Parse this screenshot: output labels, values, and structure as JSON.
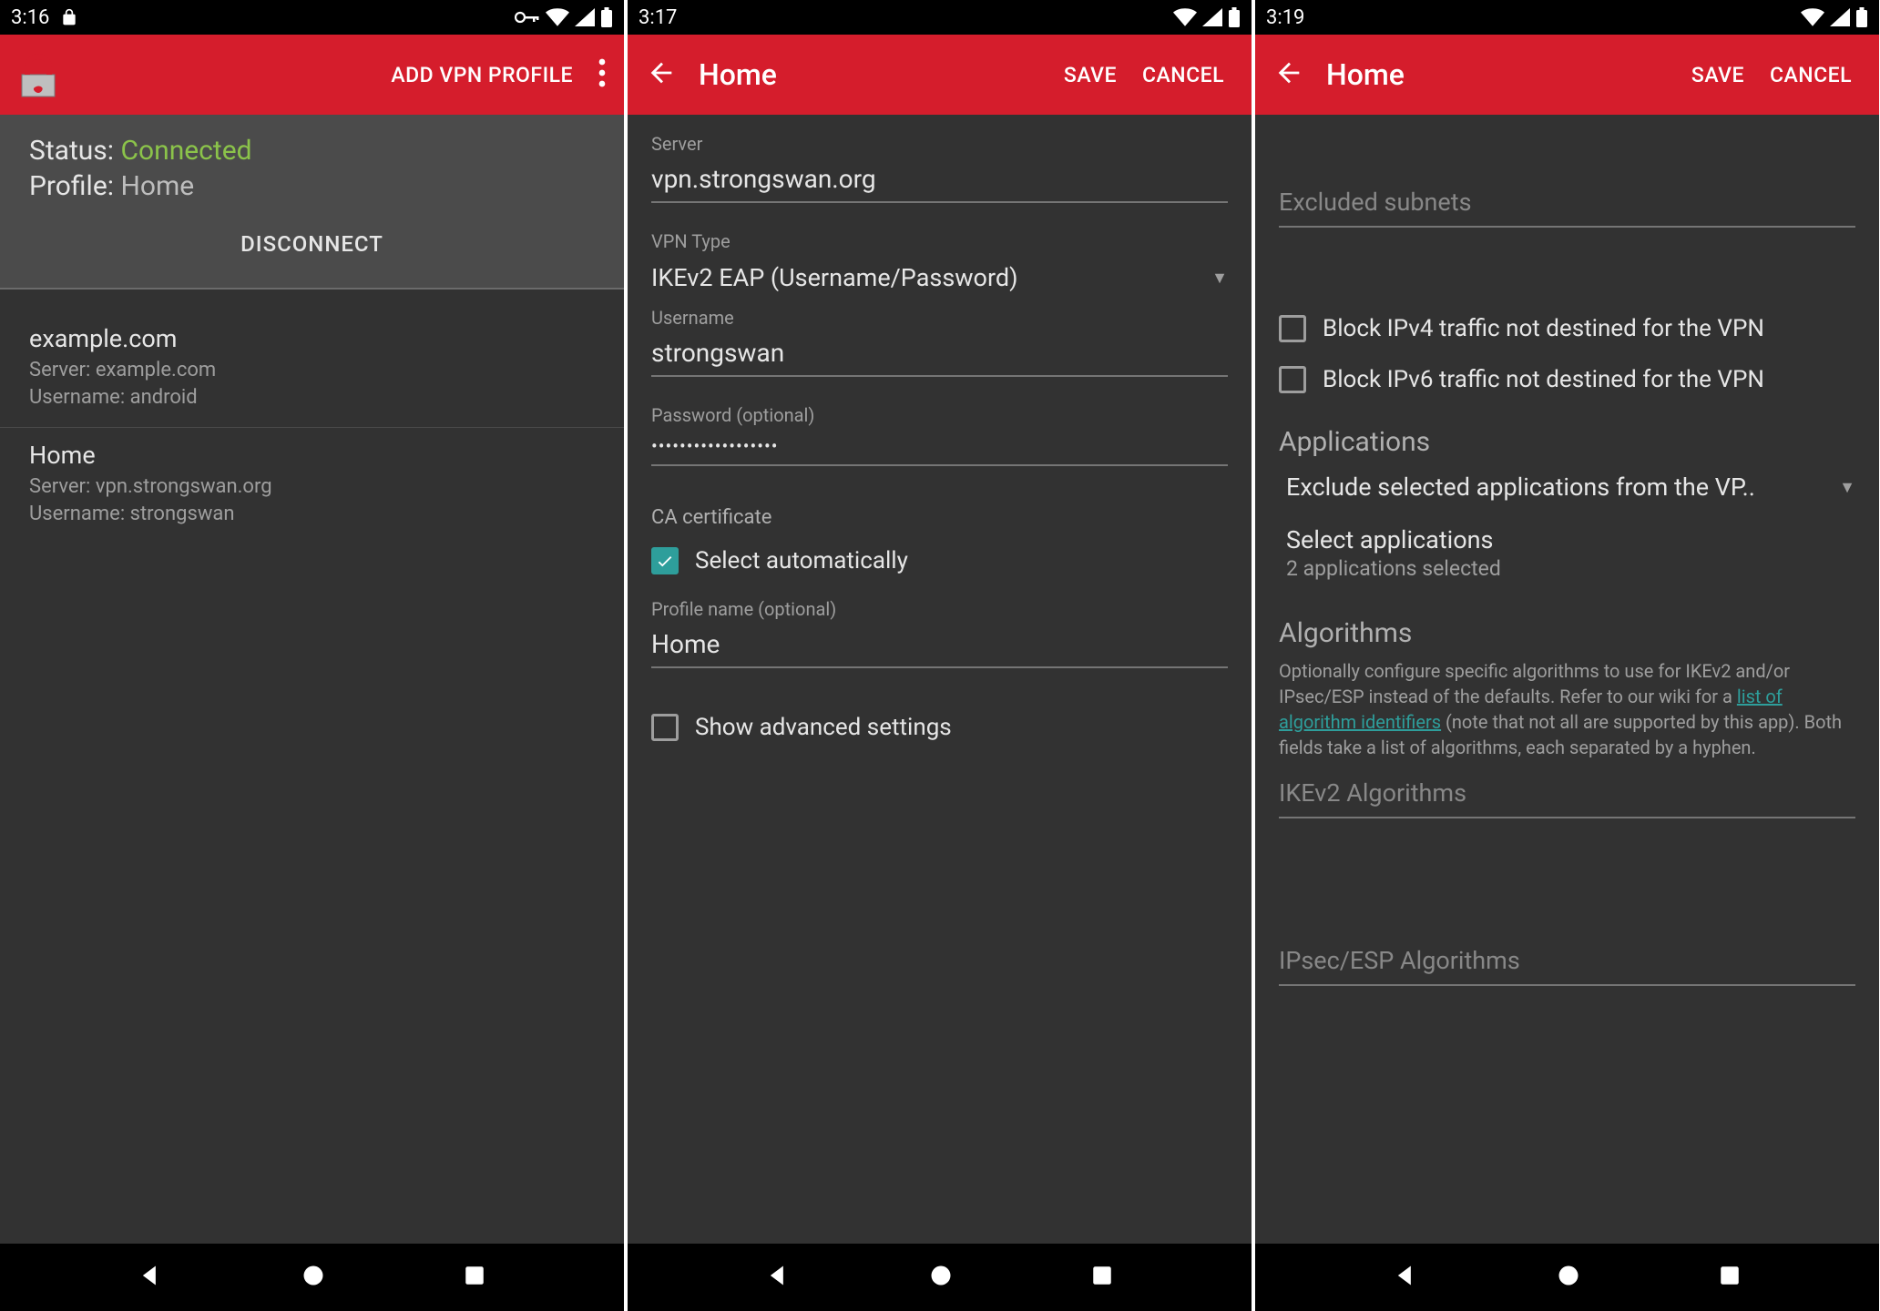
{
  "screen1": {
    "time": "3:16",
    "add_profile": "ADD VPN PROFILE",
    "status_label": "Status:",
    "status_value": "Connected",
    "profile_label": "Profile:",
    "profile_value": "Home",
    "disconnect": "DISCONNECT",
    "profiles": [
      {
        "name": "example.com",
        "server_label": "Server:",
        "server": "example.com",
        "user_label": "Username:",
        "user": "android"
      },
      {
        "name": "Home",
        "server_label": "Server:",
        "server": "vpn.strongswan.org",
        "user_label": "Username:",
        "user": "strongswan"
      }
    ]
  },
  "screen2": {
    "time": "3:17",
    "title": "Home",
    "save": "SAVE",
    "cancel": "CANCEL",
    "server_label": "Server",
    "server_value": "vpn.strongswan.org",
    "vpn_type_label": "VPN Type",
    "vpn_type_value": "IKEv2 EAP (Username/Password)",
    "username_label": "Username",
    "username_value": "strongswan",
    "password_label": "Password (optional)",
    "password_value": "••••••••••••••••••",
    "ca_label": "CA certificate",
    "ca_auto": "Select automatically",
    "profile_name_label": "Profile name (optional)",
    "profile_name_value": "Home",
    "show_advanced": "Show advanced settings"
  },
  "screen3": {
    "time": "3:19",
    "title": "Home",
    "save": "SAVE",
    "cancel": "CANCEL",
    "excluded_subnets": "Excluded subnets",
    "block_ipv4": "Block IPv4 traffic not destined for the VPN",
    "block_ipv6": "Block IPv6 traffic not destined for the VPN",
    "applications": "Applications",
    "app_mode": "Exclude selected applications from the VP..",
    "select_apps": "Select applications",
    "apps_selected": "2 applications selected",
    "algorithms": "Algorithms",
    "algo_help_pre": "Optionally configure specific algorithms to use for IKEv2 and/or IPsec/ESP instead of the defaults. Refer to our wiki for a ",
    "algo_help_link": "list of algorithm identifiers",
    "algo_help_post": " (note that not all are supported by this app). Both fields take a list of algorithms, each separated by a hyphen.",
    "ikev2_algo": "IKEv2 Algorithms",
    "ipsec_algo": "IPsec/ESP Algorithms"
  }
}
